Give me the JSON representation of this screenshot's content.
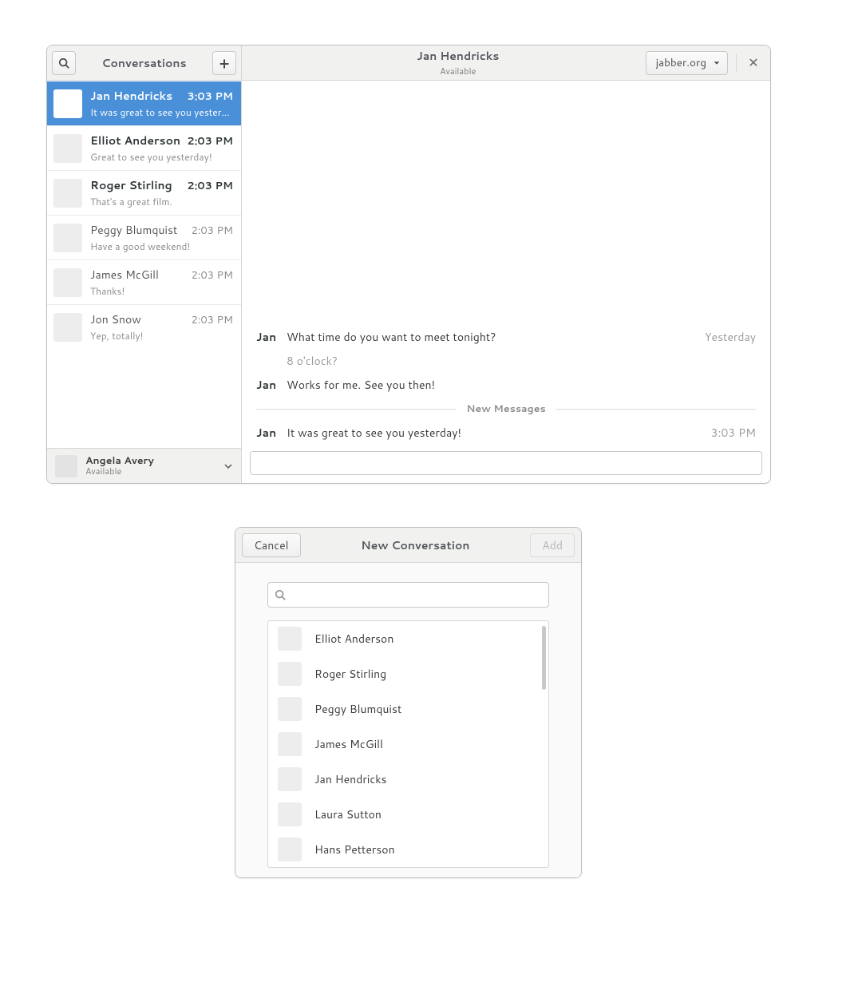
{
  "colors": {
    "accent": "#4a90d9"
  },
  "window1": {
    "sidebar": {
      "title": "Conversations",
      "items": [
        {
          "name": "Jan Hendricks",
          "time": "3:03 PM",
          "preview": "It was great to see you yesterday!",
          "selected": true,
          "unread": true
        },
        {
          "name": "Elliot Anderson",
          "time": "2:03 PM",
          "preview": "Great to see you yesterday!",
          "selected": false,
          "unread": true
        },
        {
          "name": "Roger Stirling",
          "time": "2:03 PM",
          "preview": "That's a great film.",
          "selected": false,
          "unread": true
        },
        {
          "name": "Peggy Blumquist",
          "time": "2:03 PM",
          "preview": "Have a good weekend!",
          "selected": false,
          "unread": false
        },
        {
          "name": "James McGill",
          "time": "2:03 PM",
          "preview": "Thanks!",
          "selected": false,
          "unread": false
        },
        {
          "name": "Jon Snow",
          "time": "2:03 PM",
          "preview": "Yep, totally!",
          "selected": false,
          "unread": false
        }
      ],
      "me": {
        "name": "Angela Avery",
        "status": "Available"
      }
    },
    "chat": {
      "title": "Jan Hendricks",
      "subtitle": "Available",
      "account": "jabber.org",
      "divider_label": "New Messages",
      "messages": [
        {
          "sender": "Jan",
          "body": "What time do you want to meet tonight?",
          "time": "Yesterday",
          "me": false
        },
        {
          "sender": "",
          "body": "8 o'clock?",
          "time": "",
          "me": true
        },
        {
          "sender": "Jan",
          "body": "Works for me. See you then!",
          "time": "",
          "me": false
        },
        {
          "divider": true
        },
        {
          "sender": "Jan",
          "body": "It was great to see you yesterday!",
          "time": "3:03 PM",
          "me": false
        }
      ],
      "input_value": ""
    }
  },
  "window2": {
    "title": "New Conversation",
    "cancel_label": "Cancel",
    "add_label": "Add",
    "search_value": "",
    "contacts": [
      "Elliot Anderson",
      "Roger Stirling",
      "Peggy Blumquist",
      "James McGill",
      "Jan Hendricks",
      "Laura Sutton",
      "Hans Petterson"
    ]
  }
}
